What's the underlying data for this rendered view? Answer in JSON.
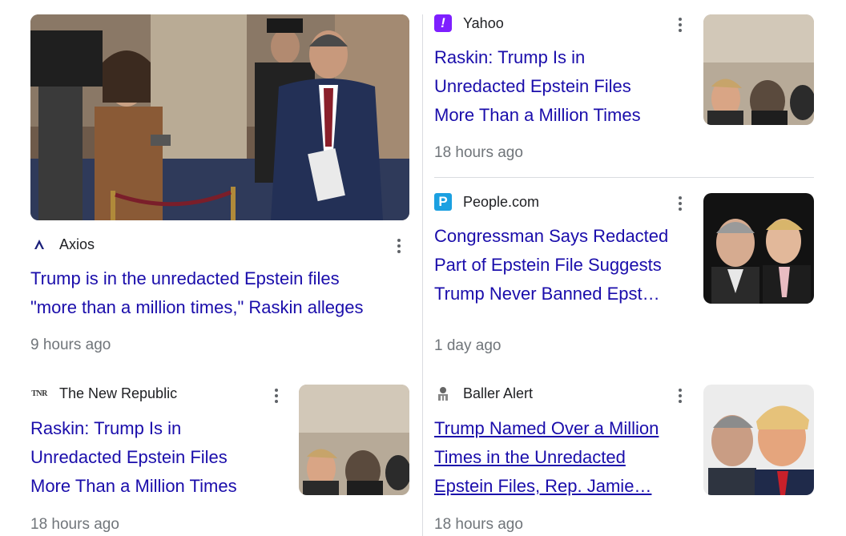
{
  "cards": [
    {
      "source": "Axios",
      "source_icon": "axios-logo-icon",
      "headline_lines": [
        "Trump is in the unredacted Epstein files",
        "\"more than a million times,\" Raskin alleges"
      ],
      "time": "9 hours ago"
    },
    {
      "source": "Yahoo",
      "source_icon": "yahoo-logo-icon",
      "headline_lines": [
        "Raskin: Trump Is in",
        "Unredacted Epstein Files",
        "More Than a Million Times"
      ],
      "time": "18 hours ago"
    },
    {
      "source": "People.com",
      "source_icon": "people-logo-icon",
      "headline_lines": [
        "Congressman Says Redacted",
        "Part of Epstein File Suggests",
        "Trump Never Banned Epst…"
      ],
      "time": "1 day ago"
    },
    {
      "source": "The New Republic",
      "source_icon": "tnr-logo-icon",
      "headline_lines": [
        "Raskin: Trump Is in",
        "Unredacted Epstein Files",
        "More Than a Million Times"
      ],
      "time": "18 hours ago"
    },
    {
      "source": "Baller Alert",
      "source_icon": "baller-alert-logo-icon",
      "headline_lines": [
        "Trump Named Over a Million",
        "Times in the Unredacted",
        "Epstein Files, Rep. Jamie…"
      ],
      "time": "18 hours ago"
    }
  ],
  "logos": {
    "yahoo_glyph": "!",
    "people_glyph": "P",
    "tnr_glyph": "TNR"
  },
  "colors": {
    "headline": "#1a0dab",
    "time": "#70757a",
    "yahoo": "#7e1fff",
    "people": "#1ba0e1"
  }
}
